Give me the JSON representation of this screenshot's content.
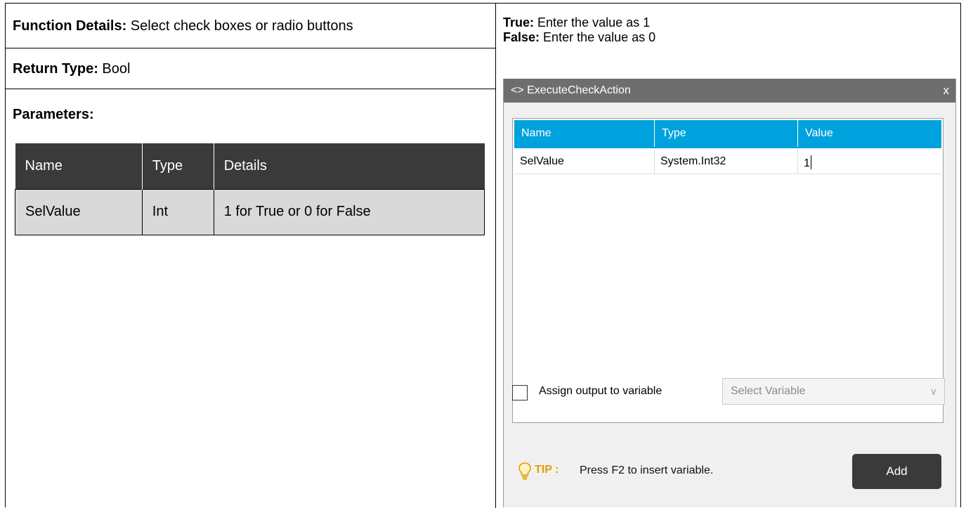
{
  "left": {
    "function_label": "Function Details:",
    "function_value": "Select check boxes or radio buttons",
    "return_label": "Return Type:",
    "return_value": "Bool",
    "parameters_label": "Parameters:",
    "table": {
      "headers": [
        "Name",
        "Type",
        "Details"
      ],
      "rows": [
        [
          "SelValue",
          "Int",
          "1 for True or 0 for False"
        ]
      ]
    }
  },
  "right": {
    "true_label": "True:",
    "true_value": "Enter the value as 1",
    "false_label": "False:",
    "false_value": "Enter the value as 0"
  },
  "dialog": {
    "title": "<> ExecuteCheckAction",
    "close": "x",
    "grid_headers": [
      "Name",
      "Type",
      "Value"
    ],
    "grid_rows": [
      [
        "SelValue",
        "System.Int32",
        "1"
      ]
    ],
    "assign_label": "Assign output to variable",
    "select_placeholder": "Select Variable",
    "tip_label": "TIP :",
    "tip_text": "Press F2 to insert variable.",
    "add_button": "Add"
  },
  "colors": {
    "header_dark": "#3a3a3a",
    "grid_header": "#00a2dd",
    "tip": "#e0a000"
  }
}
